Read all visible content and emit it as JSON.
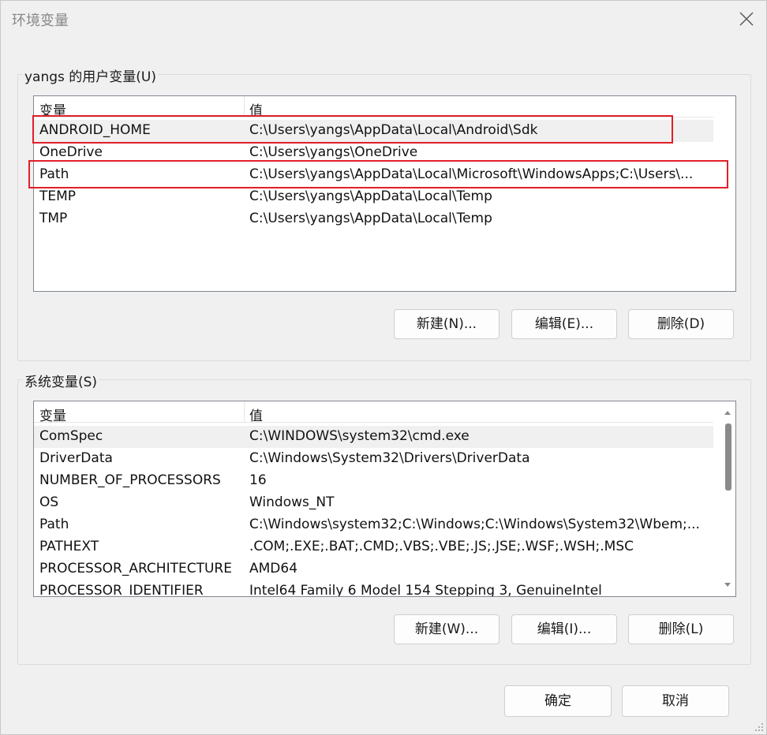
{
  "window": {
    "title": "环境变量",
    "close_icon": "close-icon"
  },
  "user_vars": {
    "group_label": "yangs 的用户变量(U)",
    "col_name": "变量",
    "col_value": "值",
    "rows": [
      {
        "name": "ANDROID_HOME",
        "value": "C:\\Users\\yangs\\AppData\\Local\\Android\\Sdk",
        "selected": true
      },
      {
        "name": "OneDrive",
        "value": "C:\\Users\\yangs\\OneDrive"
      },
      {
        "name": "Path",
        "value": "C:\\Users\\yangs\\AppData\\Local\\Microsoft\\WindowsApps;C:\\Users\\..."
      },
      {
        "name": "TEMP",
        "value": "C:\\Users\\yangs\\AppData\\Local\\Temp"
      },
      {
        "name": "TMP",
        "value": "C:\\Users\\yangs\\AppData\\Local\\Temp"
      }
    ],
    "buttons": {
      "new": "新建(N)...",
      "edit": "编辑(E)...",
      "delete": "删除(D)"
    }
  },
  "system_vars": {
    "group_label": "系统变量(S)",
    "col_name": "变量",
    "col_value": "值",
    "rows": [
      {
        "name": "ComSpec",
        "value": "C:\\WINDOWS\\system32\\cmd.exe",
        "selected": true
      },
      {
        "name": "DriverData",
        "value": "C:\\Windows\\System32\\Drivers\\DriverData"
      },
      {
        "name": "NUMBER_OF_PROCESSORS",
        "value": "16"
      },
      {
        "name": "OS",
        "value": "Windows_NT"
      },
      {
        "name": "Path",
        "value": "C:\\Windows\\system32;C:\\Windows;C:\\Windows\\System32\\Wbem;..."
      },
      {
        "name": "PATHEXT",
        "value": ".COM;.EXE;.BAT;.CMD;.VBS;.VBE;.JS;.JSE;.WSF;.WSH;.MSC"
      },
      {
        "name": "PROCESSOR_ARCHITECTURE",
        "value": "AMD64"
      },
      {
        "name": "PROCESSOR_IDENTIFIER",
        "value": "Intel64 Family 6 Model 154 Stepping 3, GenuineIntel"
      }
    ],
    "buttons": {
      "new": "新建(W)...",
      "edit": "编辑(I)...",
      "delete": "删除(L)"
    }
  },
  "footer": {
    "ok": "确定",
    "cancel": "取消"
  },
  "colors": {
    "highlight": "#e0202a",
    "selected_row": "#f0f0f0"
  }
}
